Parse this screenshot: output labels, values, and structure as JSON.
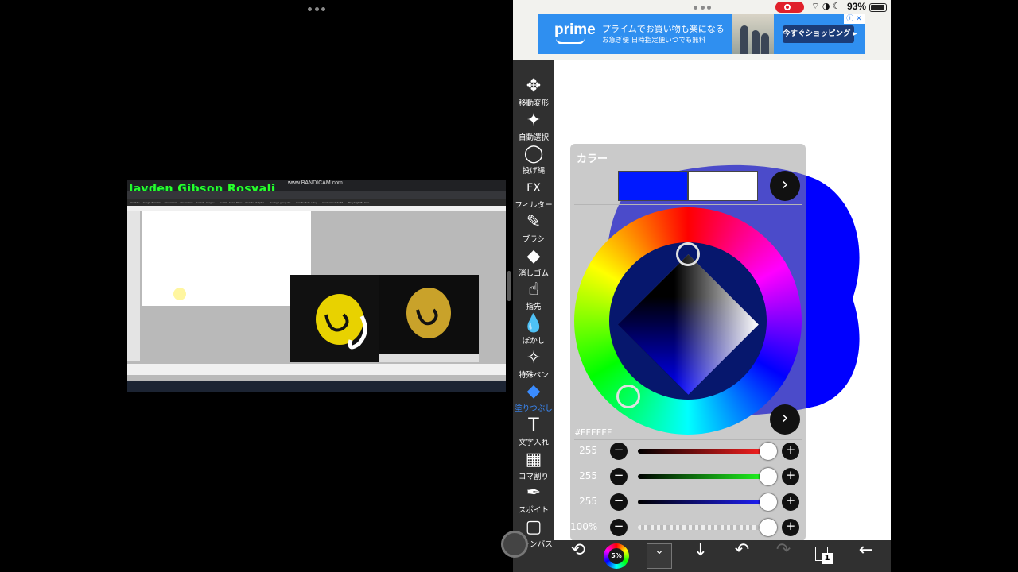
{
  "left_pane": {
    "video": {
      "watermark": "Jayden Gibson Rosvali",
      "bandicam": "www.BANDICAM.com",
      "bookmarks": [
        "YouTube",
        "Google Translate",
        "StreamYard",
        "StreamYard",
        "Scratch - Imagine...",
        "FootOr - Music Mixer",
        "Youtube Multiplier ...",
        "Seeing a group of s...",
        "How To Make a Sug...",
        "Contact Youtube Mi...",
        "They Might Be Gian..."
      ]
    }
  },
  "statusbar": {
    "icons": "⌔ ◑ ☾",
    "battery": "93%",
    "battery_level": 0.93
  },
  "ad": {
    "brand": "prime",
    "line1": "プライムでお買い物も楽になる",
    "line2": "お急ぎ便 日時指定便いつでも無料",
    "cta": "今すぐショッピング ▸",
    "close": "ⓘ ✕"
  },
  "tools": [
    {
      "label": "移動変形",
      "icon": "✥",
      "name": "tool-transform",
      "active": false
    },
    {
      "label": "自動選択",
      "icon": "✦",
      "name": "tool-magic-wand",
      "active": false
    },
    {
      "label": "投げ縄",
      "icon": "◯",
      "name": "tool-lasso",
      "active": false
    },
    {
      "label": "フィルター",
      "icon": "FX",
      "name": "tool-filter",
      "active": false
    },
    {
      "label": "ブラシ",
      "icon": "✎",
      "name": "tool-brush",
      "active": false
    },
    {
      "label": "消しゴム",
      "icon": "◆",
      "name": "tool-eraser",
      "active": false
    },
    {
      "label": "指先",
      "icon": "☝",
      "name": "tool-smudge",
      "active": false
    },
    {
      "label": "ぼかし",
      "icon": "💧",
      "name": "tool-blur",
      "active": false
    },
    {
      "label": "特殊ペン",
      "icon": "✧",
      "name": "tool-special-pen",
      "active": false
    },
    {
      "label": "塗りつぶし",
      "icon": "◆",
      "name": "tool-fill",
      "active": true
    },
    {
      "label": "文字入れ",
      "icon": "T",
      "name": "tool-text",
      "active": false
    },
    {
      "label": "コマ割り",
      "icon": "▦",
      "name": "tool-frame-divider",
      "active": false
    },
    {
      "label": "スポイト",
      "icon": "✒",
      "name": "tool-eyedropper",
      "active": false
    },
    {
      "label": "キャンバス",
      "icon": "▢",
      "name": "tool-canvas",
      "active": false
    }
  ],
  "color_panel": {
    "title": "カラー",
    "primary_color": "#0019FF",
    "secondary_color": "#FFFFFF",
    "expand_icon": "›",
    "hex": "#FFFFFF",
    "sliders": [
      {
        "name": "red",
        "value": "255",
        "color": "#ff2020",
        "level": 1.0
      },
      {
        "name": "green",
        "value": "255",
        "color": "#20ff20",
        "level": 1.0
      },
      {
        "name": "blue",
        "value": "255",
        "color": "#2020ff",
        "level": 1.0
      },
      {
        "name": "opacity",
        "value": "100%",
        "color": "#cccccc",
        "level": 1.0
      }
    ],
    "minus": "−",
    "plus": "+"
  },
  "bottombar": {
    "brush_size": "5%",
    "dropdown": "⌄",
    "down_arrow": "↓",
    "undo": "↶",
    "redo": "↷",
    "layer_count": "1",
    "back": "←",
    "rotate": "⟲"
  }
}
